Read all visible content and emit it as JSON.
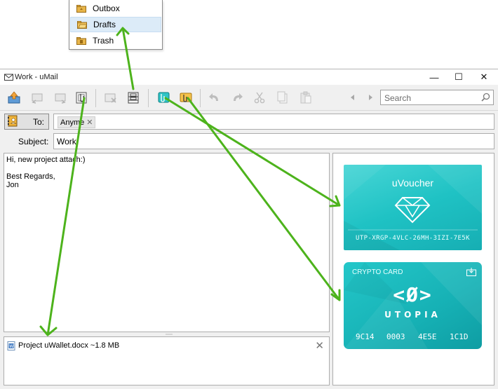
{
  "folders": {
    "items": [
      {
        "label": "Outbox"
      },
      {
        "label": "Drafts",
        "selected": true
      },
      {
        "label": "Trash"
      }
    ]
  },
  "window": {
    "title": "Work - uMail",
    "minimize": "—",
    "maximize": "☐",
    "close": "✕"
  },
  "toolbar": {
    "search_placeholder": "Search"
  },
  "compose": {
    "to_label": "To:",
    "recipient": "Anyme",
    "recipient_remove": "✕",
    "subject_label": "Subject:",
    "subject": "Work",
    "body": "Hi, new project attach:)\n\nBest Regards,\nJon"
  },
  "attachment": {
    "name": "Project uWallet.docx ~1.8 MB",
    "remove": "✕"
  },
  "voucher": {
    "title": "uVoucher",
    "code": "UTP-XRGP-4VLC-26MH-3IZI-7E5K"
  },
  "crypto_card": {
    "title": "CRYPTO CARD",
    "logo": "<Ø>",
    "brand": "UTOPIA",
    "numbers": [
      "9C14",
      "0003",
      "4E5E",
      "1C1D"
    ]
  },
  "colors": {
    "arrow": "#4db31c",
    "card_teal": "#1fc2c4"
  }
}
